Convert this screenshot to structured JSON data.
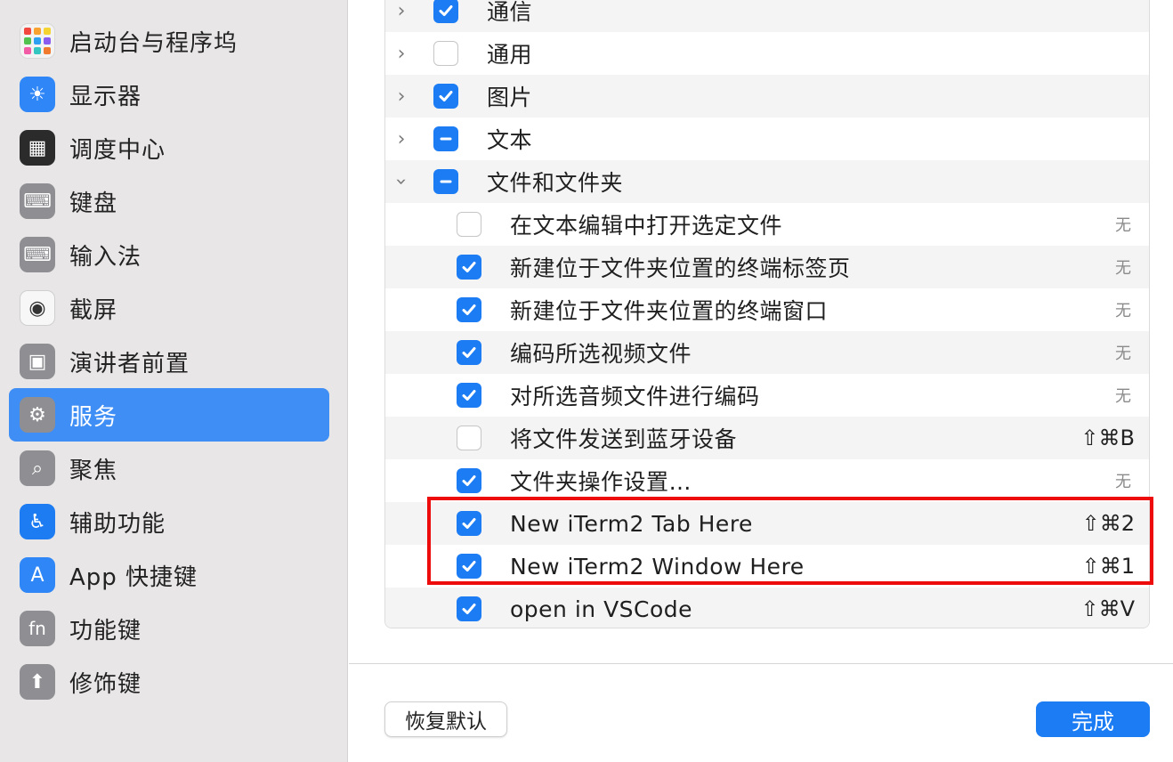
{
  "sidebar": {
    "items": [
      {
        "label": "启动台与程序坞",
        "icon": "launchpad-icon",
        "glyph": ""
      },
      {
        "label": "显示器",
        "icon": "display-sun-icon",
        "glyph": "☀"
      },
      {
        "label": "调度中心",
        "icon": "mission-control-icon",
        "glyph": "▦"
      },
      {
        "label": "键盘",
        "icon": "keyboard-icon",
        "glyph": "⌨"
      },
      {
        "label": "输入法",
        "icon": "input-method-keyboard-icon",
        "glyph": "⌨"
      },
      {
        "label": "截屏",
        "icon": "screenshot-camera-icon",
        "glyph": "◉"
      },
      {
        "label": "演讲者前置",
        "icon": "presenter-icon",
        "glyph": "▣"
      },
      {
        "label": "服务",
        "icon": "services-gears-icon",
        "glyph": "⚙"
      },
      {
        "label": "聚焦",
        "icon": "spotlight-search-icon",
        "glyph": "⌕"
      },
      {
        "label": "辅助功能",
        "icon": "accessibility-icon",
        "glyph": "♿"
      },
      {
        "label": "App 快捷键",
        "icon": "app-store-icon",
        "glyph": "A"
      },
      {
        "label": "功能键",
        "icon": "fn-key-icon",
        "glyph": "fn"
      },
      {
        "label": "修饰键",
        "icon": "modifier-up-arrow-icon",
        "glyph": "⬆"
      }
    ],
    "selected": "服务"
  },
  "services": {
    "groups": [
      {
        "label": "通信",
        "state": "checked",
        "expanded": false
      },
      {
        "label": "通用",
        "state": "unchecked",
        "expanded": false
      },
      {
        "label": "图片",
        "state": "checked",
        "expanded": false
      },
      {
        "label": "文本",
        "state": "mixed",
        "expanded": false
      },
      {
        "label": "文件和文件夹",
        "state": "mixed",
        "expanded": true
      }
    ],
    "items": [
      {
        "label": "在文本编辑中打开选定文件",
        "checked": false,
        "shortcut": "无"
      },
      {
        "label": "新建位于文件夹位置的终端标签页",
        "checked": true,
        "shortcut": "无"
      },
      {
        "label": "新建位于文件夹位置的终端窗口",
        "checked": true,
        "shortcut": "无"
      },
      {
        "label": "编码所选视频文件",
        "checked": true,
        "shortcut": "无"
      },
      {
        "label": "对所选音频文件进行编码",
        "checked": true,
        "shortcut": "无"
      },
      {
        "label": "将文件发送到蓝牙设备",
        "checked": false,
        "shortcut": "⇧⌘B"
      },
      {
        "label": "文件夹操作设置…",
        "checked": true,
        "shortcut": "无"
      },
      {
        "label": "New iTerm2 Tab Here",
        "checked": true,
        "shortcut": "⇧⌘2"
      },
      {
        "label": "New iTerm2 Window Here",
        "checked": true,
        "shortcut": "⇧⌘1"
      },
      {
        "label": "open in VSCode",
        "checked": true,
        "shortcut": "⇧⌘V"
      }
    ]
  },
  "footer": {
    "restore_label": "恢复默认",
    "done_label": "完成"
  },
  "colors": {
    "accent": "#1b7cf3",
    "highlight": "#ee0b0b"
  }
}
